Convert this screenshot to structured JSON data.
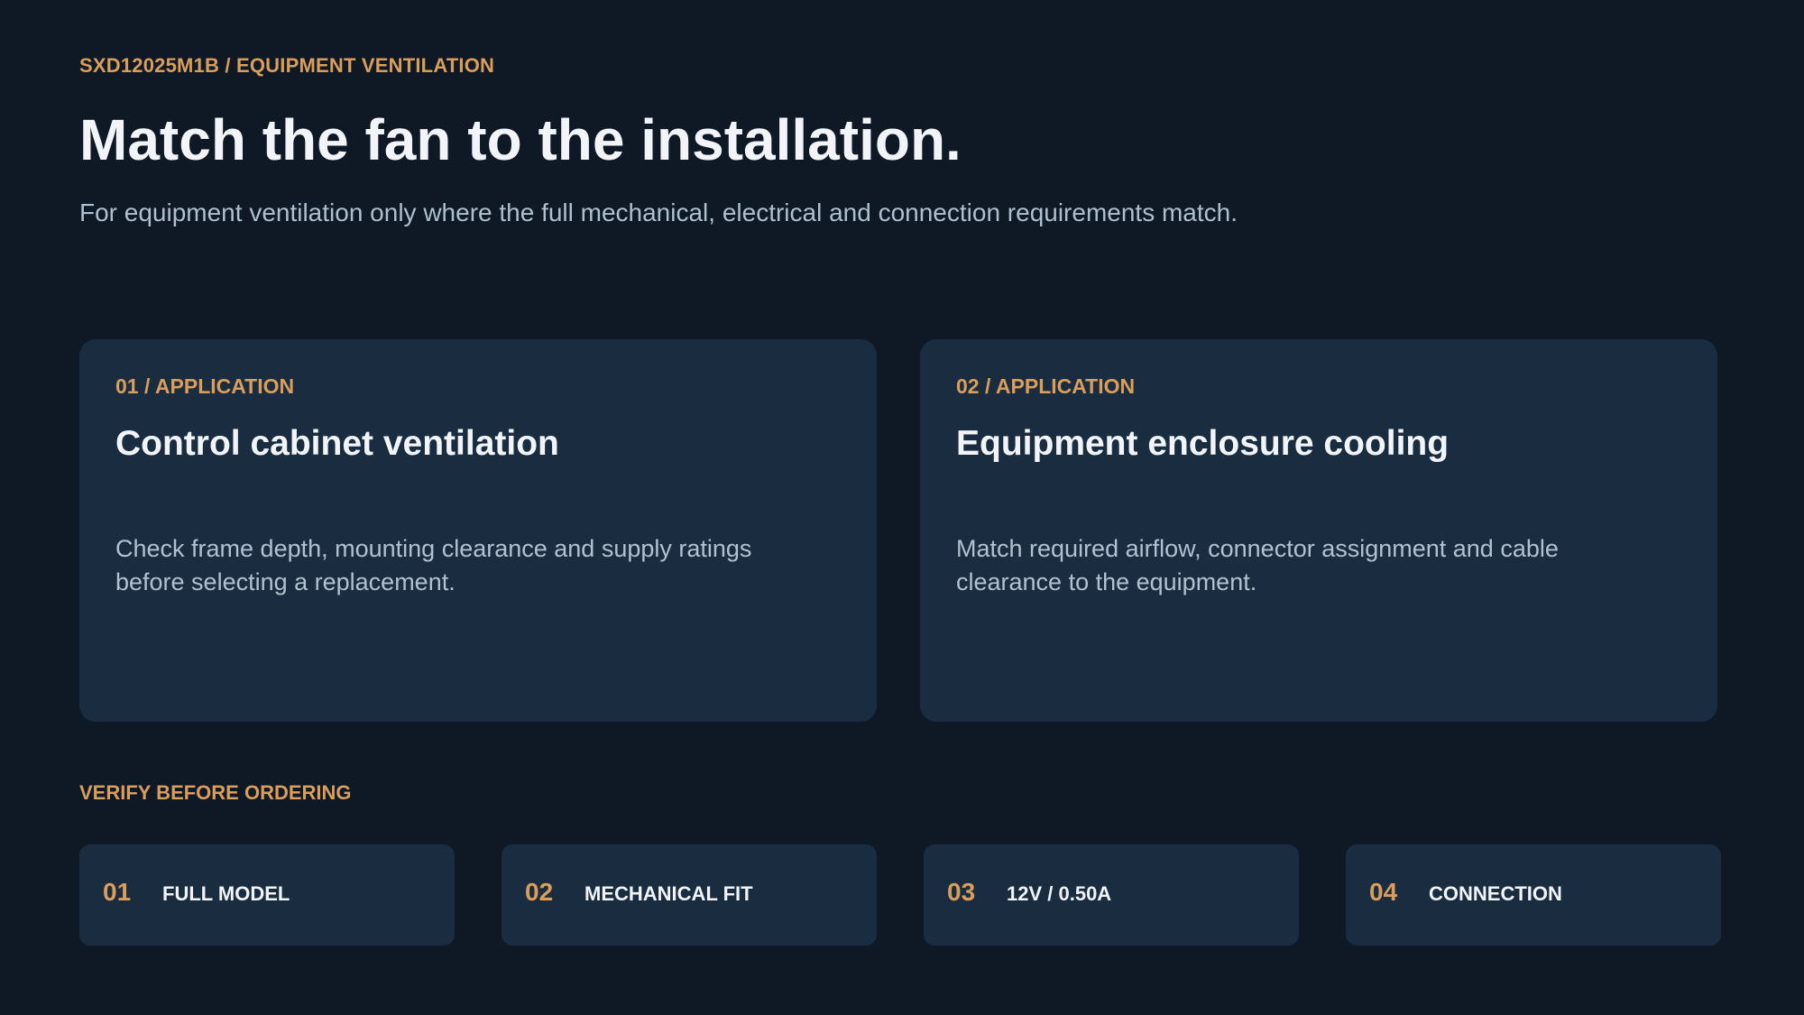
{
  "header": {
    "eyebrow": "SXD12025M1B / EQUIPMENT VENTILATION",
    "title": "Match the fan to the installation.",
    "subtitle": "For equipment ventilation only where the full mechanical, electrical and connection requirements match."
  },
  "applications": [
    {
      "kicker": "01 / APPLICATION",
      "title": "Control cabinet ventilation",
      "body": "Check frame depth, mounting clearance and supply ratings before selecting a replacement."
    },
    {
      "kicker": "02 / APPLICATION",
      "title": "Equipment enclosure cooling",
      "body": "Match required airflow, connector assignment and cable clearance to the equipment."
    }
  ],
  "verify": {
    "label": "VERIFY BEFORE ORDERING",
    "items": [
      {
        "number": "01",
        "label": "FULL MODEL"
      },
      {
        "number": "02",
        "label": "MECHANICAL FIT"
      },
      {
        "number": "03",
        "label": "12V / 0.50A"
      },
      {
        "number": "04",
        "label": "CONNECTION"
      }
    ]
  },
  "colors": {
    "background": "#0e1925",
    "card": "#1a2d40",
    "accent": "#d99d5c",
    "heading": "#f1f4f8",
    "body_text": "#aebfd0"
  }
}
